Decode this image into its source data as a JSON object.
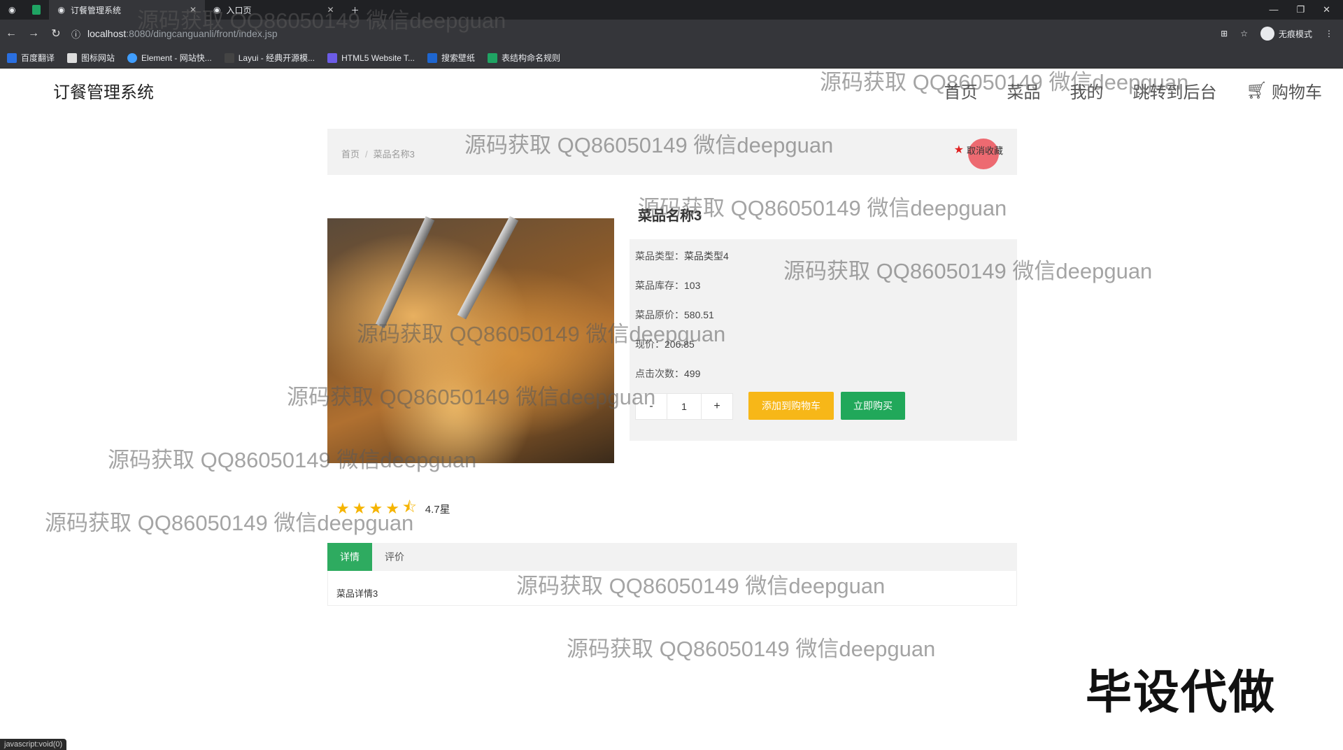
{
  "browser": {
    "tabs": [
      {
        "label": "订餐管理系统"
      },
      {
        "label": "入口页"
      }
    ],
    "url_host": "localhost",
    "url_path": ":8080/dingcanguanli/front/index.jsp",
    "incognito_label": "无痕模式",
    "bookmarks": [
      "百度翻译",
      "图标网站",
      "Element - 网站快...",
      "Layui - 经典开源模...",
      "HTML5 Website T...",
      "搜索壁纸",
      "表结构命名规则"
    ]
  },
  "header": {
    "logo": "订餐管理系统",
    "nav": [
      "首页",
      "菜品",
      "我的",
      "跳转到后台"
    ],
    "cart_label": "购物车"
  },
  "breadcrumb": {
    "home": "首页",
    "separator": "/",
    "current": "菜品名称3",
    "favorite_label": "取消收藏"
  },
  "product": {
    "title": "菜品名称3",
    "type_label": "菜品类型：",
    "type_value": "菜品类型4",
    "stock_label": "菜品库存：",
    "stock_value": "103",
    "orig_price_label": "菜品原价：",
    "orig_price_value": "580.51",
    "price_label": "现价：",
    "price_value": "206.85",
    "clicks_label": "点击次数：",
    "clicks_value": "499",
    "quantity": "1",
    "minus": "-",
    "plus": "+",
    "add_to_cart": "添加到购物车",
    "buy_now": "立即购买",
    "rating": 4.7,
    "rating_label": "4.7星"
  },
  "tabs": [
    {
      "label": "详情"
    },
    {
      "label": "评价"
    }
  ],
  "detail_text": "菜品详情3",
  "watermark_text": "源码获取 QQ86050149 微信deepguan",
  "promo_text": "毕设代做",
  "status_text": "javascript:void(0)",
  "colors": {
    "primary_green": "#2eab60",
    "cart_yellow": "#f7b718",
    "star": "#f5b400"
  }
}
